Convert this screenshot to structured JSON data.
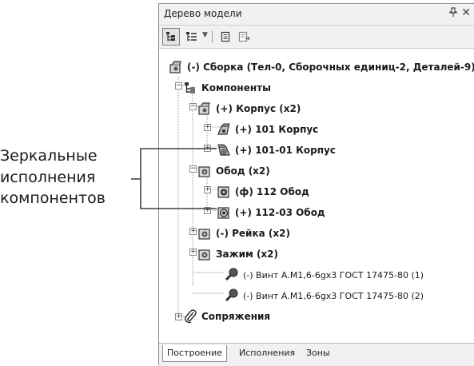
{
  "callout": {
    "line1": "Зеркальные",
    "line2": "исполнения",
    "line3": "компонентов"
  },
  "panel": {
    "title": "Дерево модели",
    "pin_glyph": "ᵩ",
    "close_glyph": "✕"
  },
  "tree": {
    "root": "(-) Сборка (Тел-0, Сборочных единиц-2, Деталей-9)",
    "components": "Компоненты",
    "korpus": "(+) Корпус (x2)",
    "korpus_101": "(+) 101 Корпус",
    "korpus_101_01": "(+) 101-01 Корпус",
    "obod": "Обод (x2)",
    "obod_112": "(ф) 112 Обод",
    "obod_112_03": "(+) 112-03 Обод",
    "reyka": "(-) Рейка (x2)",
    "zazhim": "Зажим (x2)",
    "vint1": "(-) Винт А.М1,6-6gx3 ГОСТ 17475-80 (1)",
    "vint2": "(-) Винт А.М1,6-6gx3 ГОСТ 17475-80 (2)",
    "sopryazheniya": "Сопряжения"
  },
  "tabs": {
    "build": "Построение",
    "variants": "Исполнения",
    "zones": "Зоны"
  },
  "icons": {
    "assembly": "assembly-icon",
    "components": "components-icon",
    "part": "part-icon",
    "mirror": "mirror-part-icon",
    "screw": "screw-icon",
    "mates": "paperclip-icon"
  }
}
